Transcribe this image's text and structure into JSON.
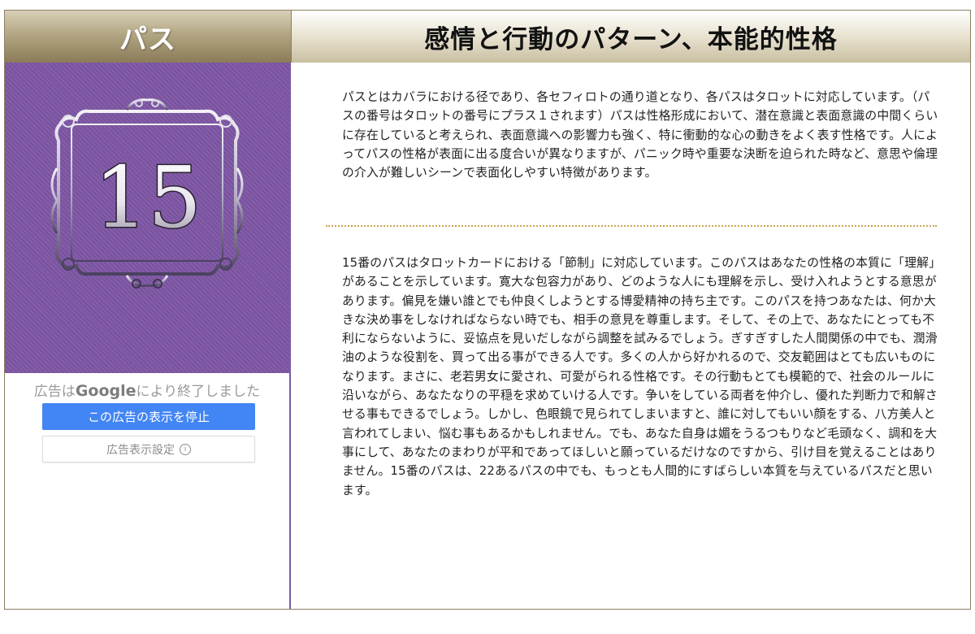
{
  "header": {
    "left_title": "パス",
    "right_title": "感情と行動のパターン、本能的性格"
  },
  "card": {
    "number": "15",
    "background_color": "#7e55a4",
    "frame_icon": "ornate-frame-icon"
  },
  "ad": {
    "status_prefix": "広告は",
    "status_brand": "Google",
    "status_suffix": "により終了しました",
    "stop_button": "この広告の表示を停止",
    "settings_button": "広告表示設定",
    "settings_icon": "info-icon",
    "accent_color": "#4285f4"
  },
  "content": {
    "paragraph1": "パスとはカバラにおける径であり、各セフィロトの通り道となり、各パスはタロットに対応しています。（パスの番号はタロットの番号にプラス１されます）パスは性格形成において、潜在意識と表面意識の中間くらいに存在していると考えられ、表面意識への影響力も強く、特に衝動的な心の動きをよく表す性格です。人によってパスの性格が表面に出る度合いが異なりますが、パニック時や重要な決断を迫られた時など、意思や倫理の介入が難しいシーンで表面化しやすい特徴があります。",
    "paragraph2": "15番のパスはタロットカードにおける「節制」に対応しています。このパスはあなたの性格の本質に「理解」があることを示しています。寛大な包容力があり、どのような人にも理解を示し、受け入れようとする意思があります。偏見を嫌い誰とでも仲良くしようとする博愛精神の持ち主です。このパスを持つあなたは、何か大きな決め事をしなければならない時でも、相手の意見を尊重します。そして、その上で、あなたにとっても不利にならないように、妥協点を見いだしながら調整を試みるでしょう。ぎすぎすした人間関係の中でも、潤滑油のような役割を、買って出る事ができる人です。多くの人から好かれるので、交友範囲はとても広いものになります。まさに、老若男女に愛され、可愛がられる性格です。その行動もとても模範的で、社会のルールに沿いながら、あなたなりの平穏を求めていける人です。争いをしている両者を仲介し、優れた判断力で和解させる事もできるでしょう。しかし、色眼鏡で見られてしまいますと、誰に対してもいい顔をする、八方美人と言われてしまい、悩む事もあるかもしれません。でも、あなた自身は媚をうるつもりなど毛頭なく、調和を大事にして、あなたのまわりが平和であってほしいと願っているだけなのですから、引け目を覚えることはありません。15番のパスは、22あるパスの中でも、もっとも人間的にすばらしい本質を与えているパスだと思います。"
  }
}
